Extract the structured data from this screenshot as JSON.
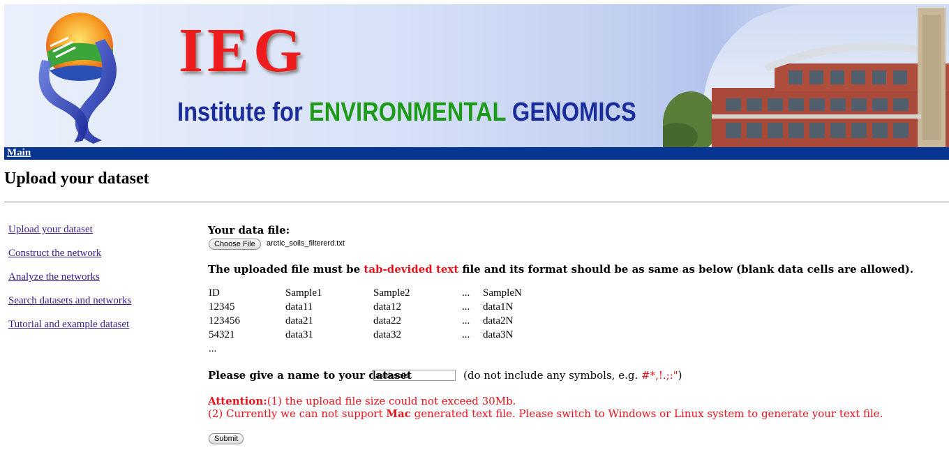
{
  "banner": {
    "acronym": "IEG",
    "subtitle_part1": "Institute for",
    "subtitle_part2": "ENVIRONMENTAL",
    "subtitle_part3": "GENOMICS"
  },
  "navbar": {
    "main_link": "Main"
  },
  "page": {
    "title": "Upload your dataset"
  },
  "sidebar": {
    "items": [
      {
        "label": "Upload your dataset"
      },
      {
        "label": "Construct the network"
      },
      {
        "label": "Analyze the networks"
      },
      {
        "label": "Search datasets and networks"
      },
      {
        "label": "Tutorial and example dataset"
      }
    ]
  },
  "form": {
    "file_label": "Your data file:",
    "choose_file_button": "Choose File",
    "file_name": "arctic_soils_filtererd.txt",
    "format_note_pre": "The uploaded file must be",
    "format_note_highlight": "tab-devided text",
    "format_note_post": "file and its format should be as same as below (blank data cells are allowed).",
    "name_label": "Please give a name to your dataset",
    "name_value": "arcticsoils",
    "name_hint_pre": "(do not include any symbols, e.g.",
    "name_hint_symbols": "#*,!.;:\"",
    "name_hint_post": ")",
    "attention_label": "Attention:",
    "attention_line1": "(1) the upload file size could not exceed 30Mb.",
    "attention_line2_pre": "(2) Currently we can not support",
    "attention_line2_bold": "Mac",
    "attention_line2_post": "generated text file. Please switch to Windows or Linux system to generate your text file.",
    "submit_button": "Submit"
  },
  "example_table": {
    "rows": [
      [
        "ID",
        "Sample1",
        "Sample2",
        "...",
        "SampleN"
      ],
      [
        "12345",
        "data11",
        "data12",
        "...",
        "data1N"
      ],
      [
        "123456",
        "data21",
        "data22",
        "...",
        "data2N"
      ],
      [
        "54321",
        "data31",
        "data32",
        "...",
        "data3N"
      ]
    ],
    "trailing": "..."
  },
  "colors": {
    "navbar_bg": "#073592",
    "accent_red": "#e8121b",
    "link_purple": "#3b1a8e"
  }
}
